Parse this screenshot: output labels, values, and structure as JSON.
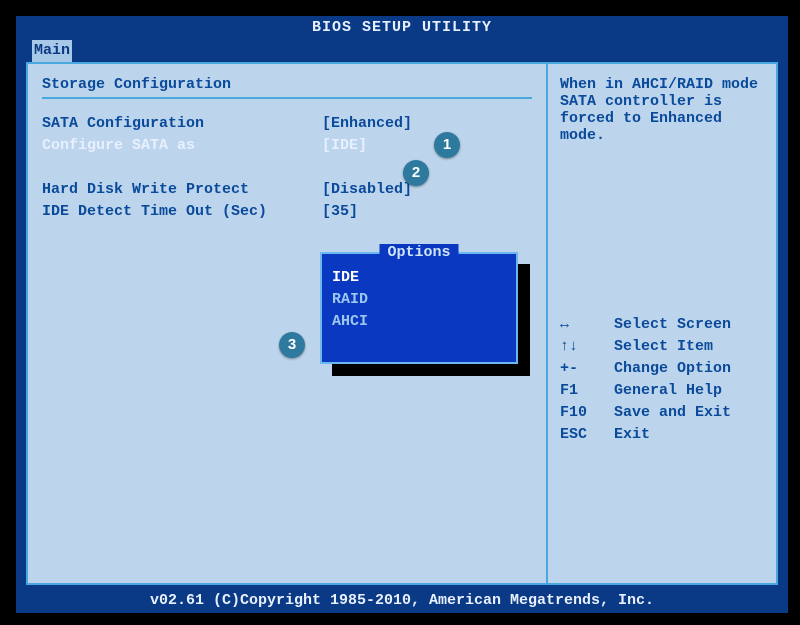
{
  "title": "BIOS SETUP UTILITY",
  "tab": "Main",
  "section_title": "Storage Configuration",
  "settings": {
    "sata_config": {
      "label": "SATA Configuration",
      "value": "[Enhanced]"
    },
    "configure_sata_as": {
      "label": "Configure SATA as",
      "value": "[IDE]"
    },
    "hd_write_protect": {
      "label": "Hard Disk Write Protect",
      "value": "[Disabled]"
    },
    "ide_detect_timeout": {
      "label": "IDE Detect Time Out (Sec)",
      "value": "[35]"
    }
  },
  "options_popup": {
    "title": "Options",
    "items": [
      "IDE",
      "RAID",
      "AHCI"
    ],
    "selected": "IDE"
  },
  "help_text": {
    "l1": "When in AHCI/RAID mode",
    "l2": "SATA controller is",
    "l3": "forced to Enhanced",
    "l4": "mode."
  },
  "nav": {
    "r1": {
      "k": "↔",
      "t": "Select Screen"
    },
    "r2": {
      "k": "↑↓",
      "t": "Select Item"
    },
    "r3": {
      "k": "+-",
      "t": "Change Option"
    },
    "r4": {
      "k": "F1",
      "t": "General Help"
    },
    "r5": {
      "k": "F10",
      "t": "Save and Exit"
    },
    "r6": {
      "k": "ESC",
      "t": "Exit"
    }
  },
  "footer": "v02.61 (C)Copyright 1985-2010, American Megatrends, Inc.",
  "callouts": {
    "c1": "1",
    "c2": "2",
    "c3": "3"
  }
}
